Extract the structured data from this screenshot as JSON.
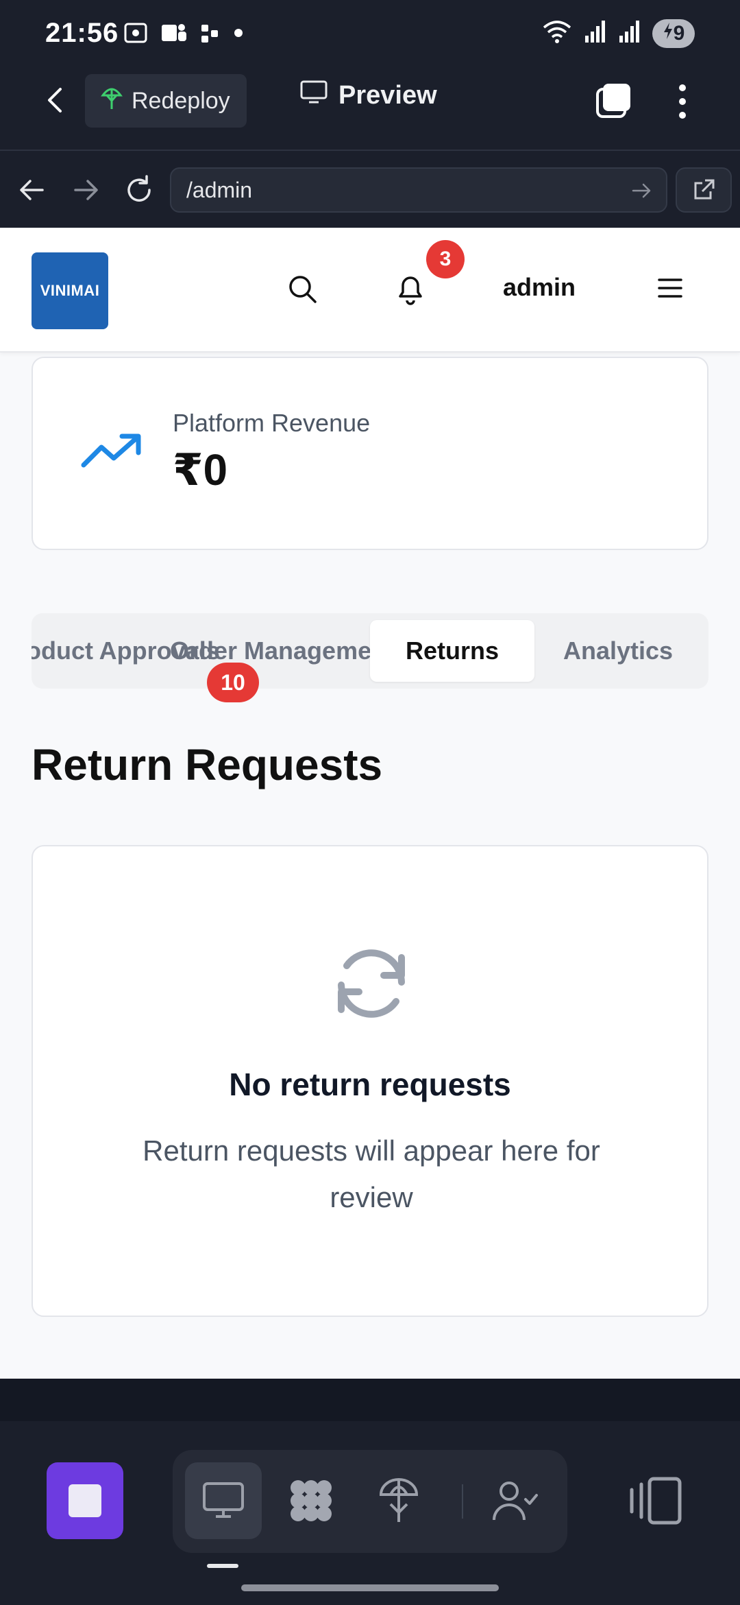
{
  "status_bar": {
    "time": "21:56",
    "battery": "9"
  },
  "app_bar": {
    "redeploy_label": "Redeploy",
    "preview_label": "Preview"
  },
  "browser": {
    "url": "/admin"
  },
  "site_header": {
    "logo_text": "VINIMAI",
    "notification_count": "3",
    "username": "admin"
  },
  "revenue_card": {
    "label": "Platform Revenue",
    "value": "₹0"
  },
  "tabs": {
    "product_approvals": "Product Approvals",
    "orders_badge": "10",
    "order_management": "Order Management",
    "returns": "Returns",
    "analytics": "Analytics"
  },
  "section": {
    "title": "Return Requests"
  },
  "empty_state": {
    "title": "No return requests",
    "description": "Return requests will appear here for review"
  },
  "colors": {
    "accent": "#6d3be0",
    "logo": "#1f63b3",
    "badge": "#e53935",
    "trend": "#1e88e5"
  }
}
